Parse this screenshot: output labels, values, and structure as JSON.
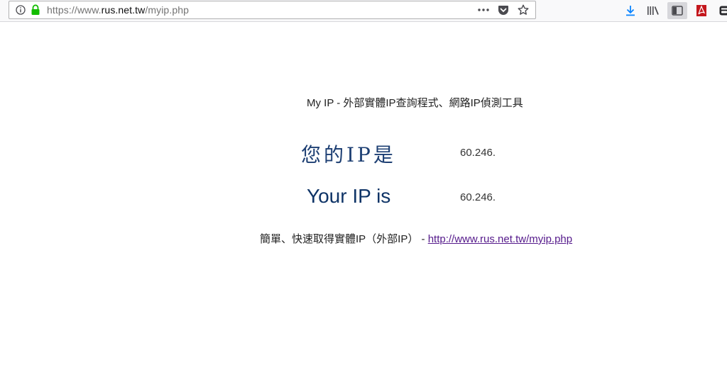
{
  "browser": {
    "url_prefix": "https://www.",
    "url_host": "rus.net.tw",
    "url_path": "/myip.php"
  },
  "page": {
    "title": "My IP - 外部實體IP查詢程式、網路IP偵測工具",
    "label_zh": "您的IP是",
    "label_en": "Your IP is",
    "ip_value_zh": "60.246.",
    "ip_value_en": "60.246.",
    "footer_text": "簡單、快速取得實體IP（外部IP） - ",
    "footer_link": "http://www.rus.net.tw/myip.php"
  },
  "colors": {
    "label_zh": "#1d3f73",
    "label_en": "#0f3467",
    "link": "#551a8b",
    "download_icon": "#0a84ff",
    "pdf_icon": "#c4171d"
  },
  "icons": [
    "info-icon",
    "lock-icon",
    "page-actions-icon",
    "pocket-icon",
    "bookmark-star-icon",
    "download-icon",
    "library-icon",
    "sidebar-icon",
    "pdf-icon",
    "profile-icon"
  ]
}
